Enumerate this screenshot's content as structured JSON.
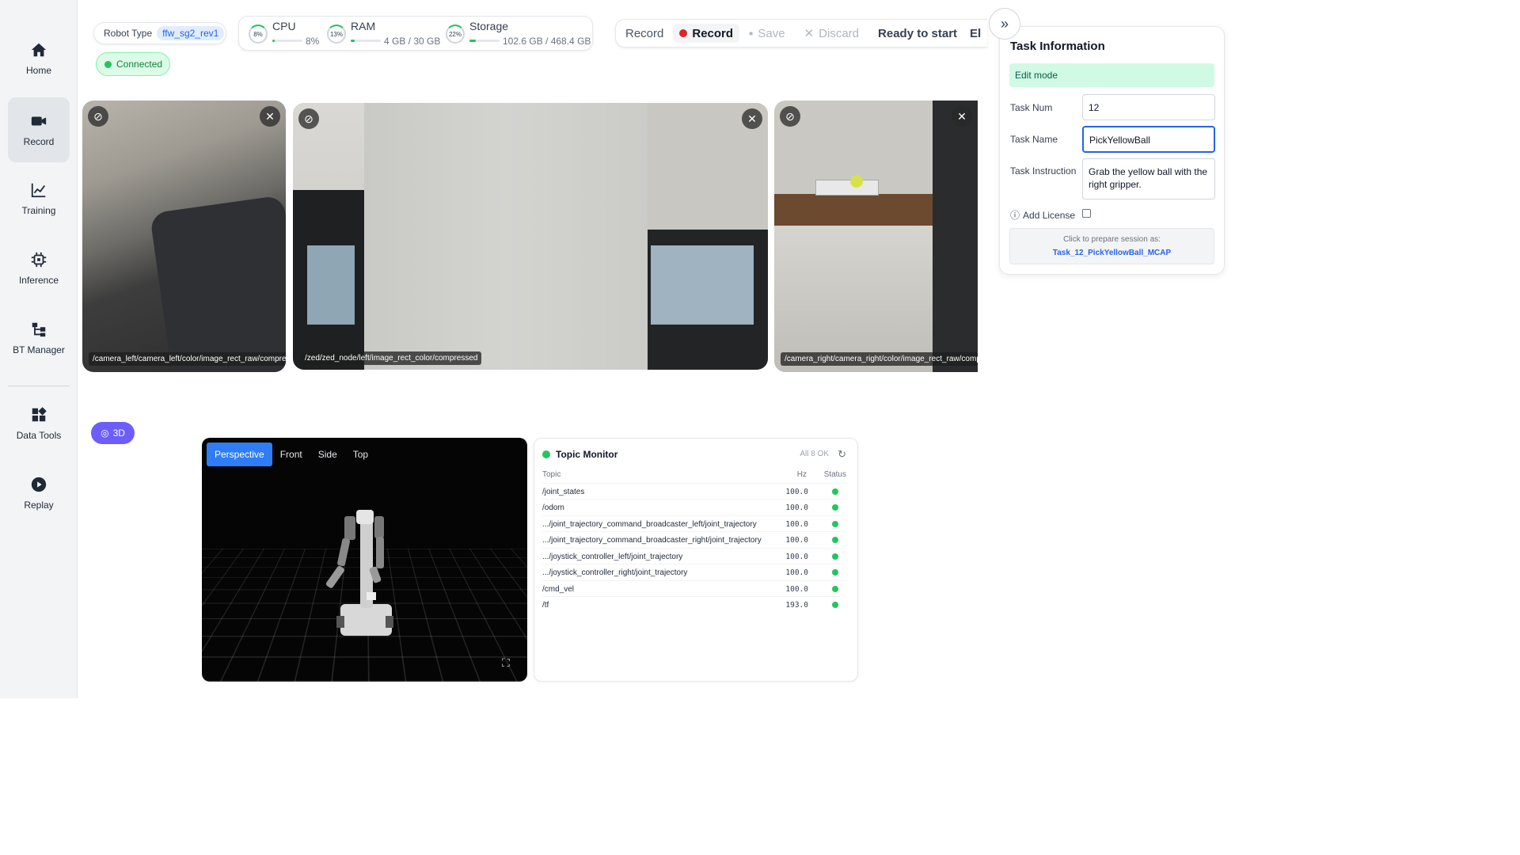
{
  "sidebar": {
    "items": [
      {
        "label": "Home",
        "icon": "home-icon"
      },
      {
        "label": "Record",
        "icon": "video-camera-icon"
      },
      {
        "label": "Training",
        "icon": "line-chart-icon"
      },
      {
        "label": "Inference",
        "icon": "chip-icon"
      },
      {
        "label": "BT Manager",
        "icon": "tree-icon"
      },
      {
        "label": "Data Tools",
        "icon": "grid-icon"
      },
      {
        "label": "Replay",
        "icon": "play-icon"
      }
    ],
    "active": "Record"
  },
  "status": {
    "robot_type_label": "Robot Type",
    "robot_type_value": "ffw_sg2_rev1",
    "connection": "Connected"
  },
  "system": {
    "cpu": {
      "label": "CPU",
      "ring": "8%",
      "value": "8%",
      "percent": 8
    },
    "ram": {
      "label": "RAM",
      "ring": "13%",
      "value": "4 GB / 30 GB",
      "percent": 13
    },
    "storage": {
      "label": "Storage",
      "ring": "22%",
      "value": "102.6 GB / 468.4 GB",
      "percent": 22
    }
  },
  "recording": {
    "record_label": "Record",
    "record_button": "Record",
    "save_button": "Save",
    "discard_button": "Discard",
    "status": "Ready to start",
    "truncated": "El"
  },
  "cameras": [
    {
      "topic": "/camera_left/camera_left/color/image_rect_raw/compressed"
    },
    {
      "topic": "/zed/zed_node/left/image_rect_color/compressed"
    },
    {
      "topic": "/camera_right/camera_right/color/image_rect_raw/compressed"
    }
  ],
  "viewer": {
    "toggle_label": "3D",
    "tabs": [
      "Perspective",
      "Front",
      "Side",
      "Top"
    ],
    "active_tab": "Perspective"
  },
  "topic_monitor": {
    "title": "Topic Monitor",
    "summary": "All 8 OK",
    "columns": [
      "Topic",
      "Hz",
      "Status"
    ],
    "rows": [
      {
        "topic": "/joint_states",
        "hz": "100.0"
      },
      {
        "topic": "/odom",
        "hz": "100.0"
      },
      {
        "topic": ".../joint_trajectory_command_broadcaster_left/joint_trajectory",
        "hz": "100.0"
      },
      {
        "topic": ".../joint_trajectory_command_broadcaster_right/joint_trajectory",
        "hz": "100.0"
      },
      {
        "topic": ".../joystick_controller_left/joint_trajectory",
        "hz": "100.0"
      },
      {
        "topic": ".../joystick_controller_right/joint_trajectory",
        "hz": "100.0"
      },
      {
        "topic": "/cmd_vel",
        "hz": "100.0"
      },
      {
        "topic": "/tf",
        "hz": "193.0"
      }
    ]
  },
  "task": {
    "title": "Task Information",
    "mode": "Edit mode",
    "num_label": "Task Num",
    "num_value": "12",
    "name_label": "Task Name",
    "name_value": "PickYellowBall",
    "instruction_label": "Task Instruction",
    "instruction_value": "Grab the yellow ball with the right gripper.",
    "license_label": "Add License",
    "prepare_hint": "Click to prepare session as:",
    "prepare_value": "Task_12_PickYellowBall_MCAP"
  },
  "colors": {
    "accent": "#2f7df6",
    "success": "#22c55e",
    "record_red": "#dc2626",
    "toggle_purple": "#6d5dfc"
  }
}
